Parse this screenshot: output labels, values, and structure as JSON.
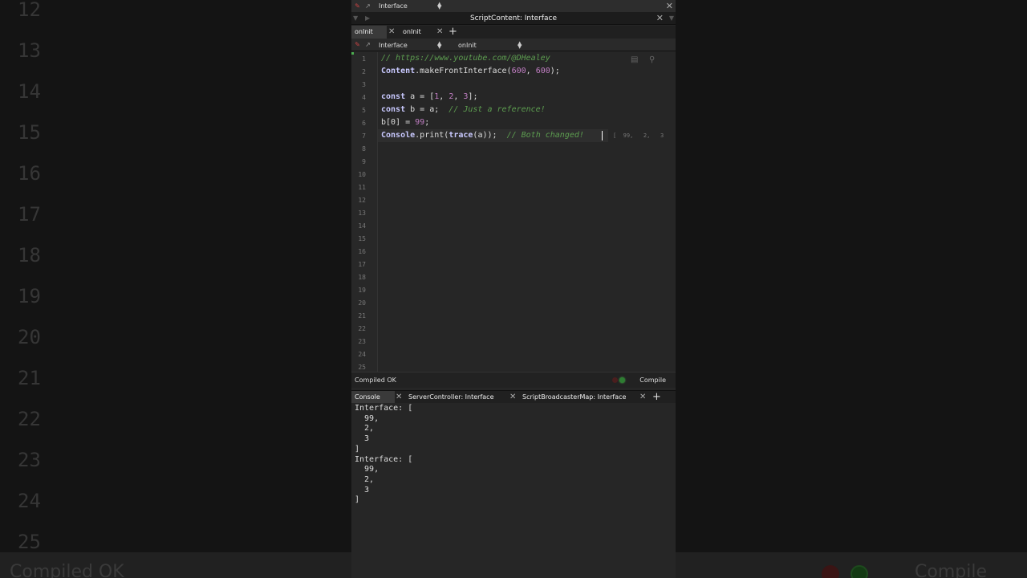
{
  "header": {
    "combo_label": "Interface",
    "window_title": "ScriptContent: Interface"
  },
  "tabs": [
    {
      "label": "onInit",
      "active": true
    },
    {
      "label": "onInit",
      "active": false
    }
  ],
  "sub_toolbar": {
    "processor_label": "Interface",
    "callback_label": "onInit"
  },
  "editor": {
    "line_numbers": [
      "1",
      "2",
      "3",
      "4",
      "5",
      "6",
      "7",
      "8",
      "9",
      "10",
      "11",
      "12",
      "13",
      "14",
      "15",
      "16",
      "17",
      "18",
      "19",
      "20",
      "21",
      "22",
      "23",
      "24",
      "25"
    ],
    "lines": [
      {
        "segments": [
          {
            "t": "// https://www.youtube.com/@DHealey",
            "c": "cm"
          }
        ]
      },
      {
        "segments": [
          {
            "t": "Content",
            "c": "kw"
          },
          {
            "t": ".makeFrontInterface(",
            "c": ""
          },
          {
            "t": "600",
            "c": "num"
          },
          {
            "t": ", ",
            "c": ""
          },
          {
            "t": "600",
            "c": "num"
          },
          {
            "t": ");",
            "c": ""
          }
        ]
      },
      {
        "segments": []
      },
      {
        "segments": [
          {
            "t": "const",
            "c": "kw"
          },
          {
            "t": " a = [",
            "c": ""
          },
          {
            "t": "1",
            "c": "num"
          },
          {
            "t": ", ",
            "c": ""
          },
          {
            "t": "2",
            "c": "num"
          },
          {
            "t": ", ",
            "c": ""
          },
          {
            "t": "3",
            "c": "num"
          },
          {
            "t": "];",
            "c": ""
          }
        ]
      },
      {
        "segments": [
          {
            "t": "const",
            "c": "kw"
          },
          {
            "t": " b = a;  ",
            "c": ""
          },
          {
            "t": "// Just a reference!",
            "c": "cm"
          }
        ]
      },
      {
        "segments": [
          {
            "t": "b[0] = ",
            "c": ""
          },
          {
            "t": "99",
            "c": "num"
          },
          {
            "t": ";",
            "c": ""
          }
        ]
      },
      {
        "segments": [
          {
            "t": "Console",
            "c": "kw"
          },
          {
            "t": ".print(",
            "c": ""
          },
          {
            "t": "trace",
            "c": "kw"
          },
          {
            "t": "(a));  ",
            "c": ""
          },
          {
            "t": "// Both changed!",
            "c": "cm"
          }
        ]
      }
    ],
    "inline_value": "[  99,   2,   3"
  },
  "status": {
    "message": "Compiled OK",
    "compile_label": "Compile"
  },
  "console_tabs": [
    {
      "label": "Console"
    },
    {
      "label": "ServerController: Interface"
    },
    {
      "label": "ScriptBroadcasterMap: Interface"
    }
  ],
  "console_output": [
    "Interface: [",
    "  99,",
    "  2,",
    "  3",
    "]",
    "Interface: [",
    "  99,",
    "  2,",
    "  3",
    "]"
  ],
  "background": {
    "line_numbers": [
      "12",
      "13",
      "14",
      "15",
      "16",
      "17",
      "18",
      "19",
      "20",
      "21",
      "22",
      "23",
      "24",
      "25"
    ],
    "status_message": "Compiled OK",
    "compile_label": "Compile"
  },
  "icons": {
    "red": "#cc4444",
    "green_led": "#2e7d32"
  }
}
